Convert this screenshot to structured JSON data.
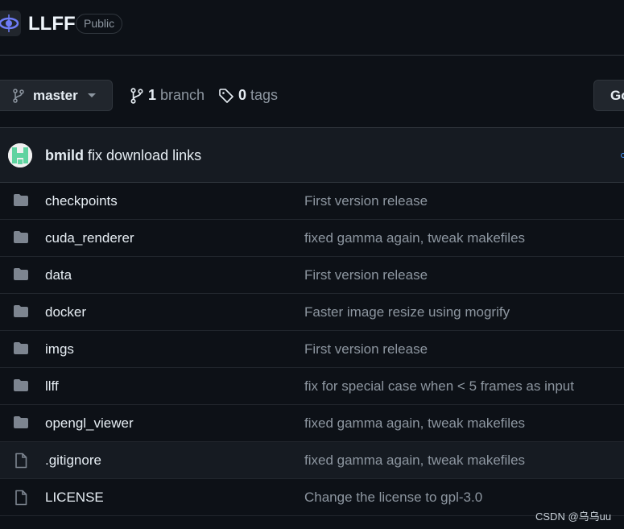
{
  "repo": {
    "name": "LLFF",
    "visibility": "Public"
  },
  "toolbar": {
    "branch": "master",
    "branch_count": "1",
    "branch_label": "branch",
    "tag_count": "0",
    "tag_label": "tags",
    "go_button": "Go"
  },
  "commit": {
    "author": "bmild",
    "message": "fix download links"
  },
  "files": [
    {
      "name": "checkpoints",
      "type": "folder",
      "commit": "First version release"
    },
    {
      "name": "cuda_renderer",
      "type": "folder",
      "commit": "fixed gamma again, tweak makefiles"
    },
    {
      "name": "data",
      "type": "folder",
      "commit": "First version release"
    },
    {
      "name": "docker",
      "type": "folder",
      "commit": "Faster image resize using mogrify"
    },
    {
      "name": "imgs",
      "type": "folder",
      "commit": "First version release"
    },
    {
      "name": "llff",
      "type": "folder",
      "commit": "fix for special case when < 5 frames as input"
    },
    {
      "name": "opengl_viewer",
      "type": "folder",
      "commit": "fixed gamma again, tweak makefiles"
    },
    {
      "name": ".gitignore",
      "type": "file",
      "commit": "fixed gamma again, tweak makefiles"
    },
    {
      "name": "LICENSE",
      "type": "file",
      "commit": "Change the license to gpl-3.0"
    }
  ],
  "watermark": "CSDN @乌乌uu"
}
